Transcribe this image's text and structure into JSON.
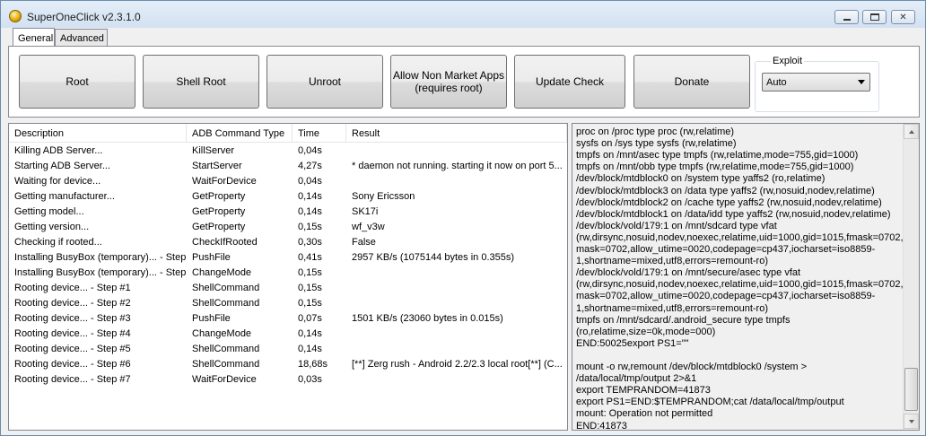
{
  "window": {
    "title": "SuperOneClick v2.3.1.0"
  },
  "icons": {
    "app": "app-icon",
    "minimize": "minimize-icon",
    "maximize": "maximize-icon",
    "close": "close-icon"
  },
  "tabs": [
    {
      "label": "General",
      "active": true
    },
    {
      "label": "Advanced",
      "active": false
    }
  ],
  "buttons": [
    {
      "label": "Root"
    },
    {
      "label": "Shell Root"
    },
    {
      "label": "Unroot"
    },
    {
      "label": "Allow Non Market Apps\n(requires root)"
    },
    {
      "label": "Update Check"
    },
    {
      "label": "Donate"
    }
  ],
  "exploit": {
    "label": "Exploit",
    "selected": "Auto"
  },
  "table": {
    "columns": [
      "Description",
      "ADB Command Type",
      "Time",
      "Result"
    ],
    "rows": [
      [
        "Killing ADB Server...",
        "KillServer",
        "0,04s",
        ""
      ],
      [
        "Starting ADB Server...",
        "StartServer",
        "4,27s",
        "* daemon not running. starting it now on port 5..."
      ],
      [
        "Waiting for device...",
        "WaitForDevice",
        "0,04s",
        ""
      ],
      [
        "Getting manufacturer...",
        "GetProperty",
        "0,14s",
        "Sony Ericsson"
      ],
      [
        "Getting model...",
        "GetProperty",
        "0,14s",
        "SK17i"
      ],
      [
        "Getting version...",
        "GetProperty",
        "0,15s",
        "wf_v3w"
      ],
      [
        "Checking if rooted...",
        "CheckIfRooted",
        "0,30s",
        "False"
      ],
      [
        "Installing BusyBox (temporary)... - Step...",
        "PushFile",
        "0,41s",
        "2957 KB/s (1075144 bytes in 0.355s)"
      ],
      [
        "Installing BusyBox (temporary)... - Step...",
        "ChangeMode",
        "0,15s",
        ""
      ],
      [
        "Rooting device... - Step #1",
        "ShellCommand",
        "0,15s",
        ""
      ],
      [
        "Rooting device... - Step #2",
        "ShellCommand",
        "0,15s",
        ""
      ],
      [
        "Rooting device... - Step #3",
        "PushFile",
        "0,07s",
        "1501 KB/s (23060 bytes in 0.015s)"
      ],
      [
        "Rooting device... - Step #4",
        "ChangeMode",
        "0,14s",
        ""
      ],
      [
        "Rooting device... - Step #5",
        "ShellCommand",
        "0,14s",
        ""
      ],
      [
        "Rooting device... - Step #6",
        "ShellCommand",
        "18,68s",
        "[**] Zerg rush - Android 2.2/2.3 local root[**] (C..."
      ],
      [
        "Rooting device... - Step #7",
        "WaitForDevice",
        "0,03s",
        ""
      ]
    ]
  },
  "log": {
    "lines": [
      "proc on /proc type proc (rw,relatime)",
      "sysfs on /sys type sysfs (rw,relatime)",
      "tmpfs on /mnt/asec type tmpfs (rw,relatime,mode=755,gid=1000)",
      "tmpfs on /mnt/obb type tmpfs (rw,relatime,mode=755,gid=1000)",
      "/dev/block/mtdblock0 on /system type yaffs2 (ro,relatime)",
      "/dev/block/mtdblock3 on /data type yaffs2 (rw,nosuid,nodev,relatime)",
      "/dev/block/mtdblock2 on /cache type yaffs2 (rw,nosuid,nodev,relatime)",
      "/dev/block/mtdblock1 on /data/idd type yaffs2 (rw,nosuid,nodev,relatime)",
      "/dev/block/vold/179:1 on /mnt/sdcard type vfat",
      "(rw,dirsync,nosuid,nodev,noexec,relatime,uid=1000,gid=1015,fmask=0702,d",
      "mask=0702,allow_utime=0020,codepage=cp437,iocharset=iso8859-",
      "1,shortname=mixed,utf8,errors=remount-ro)",
      "/dev/block/vold/179:1 on /mnt/secure/asec type vfat",
      "(rw,dirsync,nosuid,nodev,noexec,relatime,uid=1000,gid=1015,fmask=0702,d",
      "mask=0702,allow_utime=0020,codepage=cp437,iocharset=iso8859-",
      "1,shortname=mixed,utf8,errors=remount-ro)",
      "tmpfs on /mnt/sdcard/.android_secure type tmpfs",
      "(ro,relatime,size=0k,mode=000)",
      "END:50025export PS1=\"\"",
      "",
      "mount -o rw,remount /dev/block/mtdblock0 /system >",
      "/data/local/tmp/output 2>&1",
      "export TEMPRANDOM=41873",
      "export PS1=END:$TEMPRANDOM;cat /data/local/tmp/output",
      "mount: Operation not permitted",
      "END:41873"
    ]
  }
}
